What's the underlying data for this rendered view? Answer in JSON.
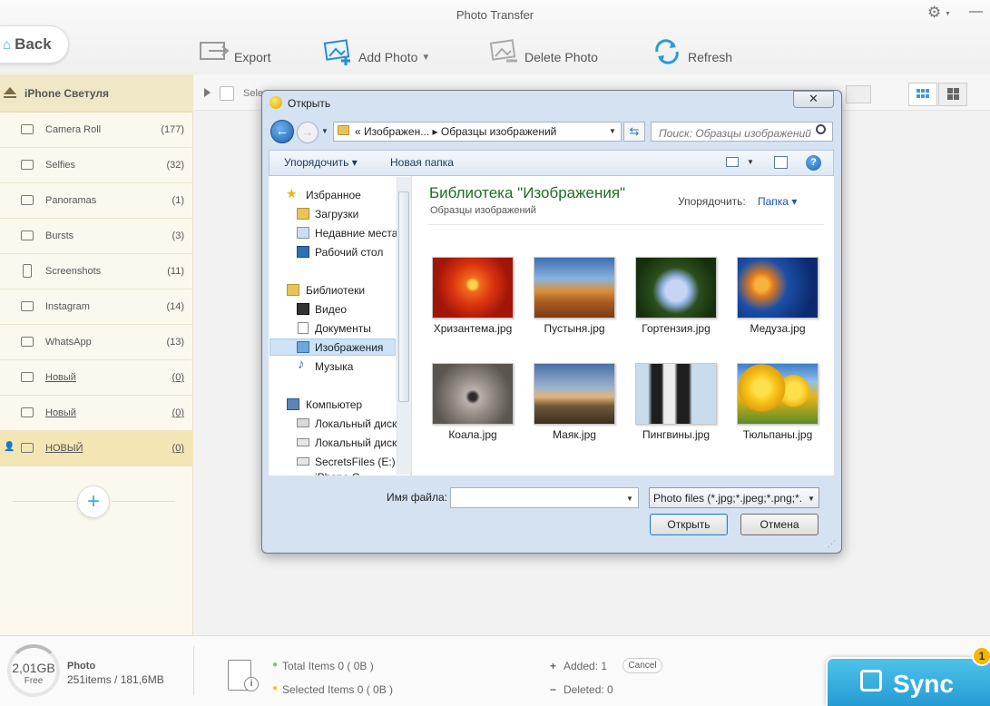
{
  "app": {
    "title": "Photo Transfer",
    "back_label": "Back"
  },
  "toolbar": {
    "export": "Export",
    "add_photo": "Add Photo",
    "delete_photo": "Delete Photo",
    "refresh": "Refresh"
  },
  "sidebar": {
    "device": "iPhone Светуля",
    "albums": [
      {
        "name": "Camera Roll",
        "count": "(177)"
      },
      {
        "name": "Selfies",
        "count": "(32)"
      },
      {
        "name": "Panoramas",
        "count": "(1)"
      },
      {
        "name": "Bursts",
        "count": "(3)"
      },
      {
        "name": "Screenshots",
        "count": "(11)"
      },
      {
        "name": "Instagram",
        "count": "(14)"
      },
      {
        "name": "WhatsApp",
        "count": "(13)"
      },
      {
        "name": "Новый",
        "count": "(0)"
      },
      {
        "name": "Новый",
        "count": "(0)"
      },
      {
        "name": "НОВЫЙ",
        "count": "(0)"
      }
    ]
  },
  "main": {
    "select_label": "Sele"
  },
  "footer": {
    "storage_size": "2,01GB",
    "storage_free": "Free",
    "storage_label": "Photo",
    "storage_detail": "251items / 181,6MB",
    "total_items": "Total Items 0 ( 0B )",
    "selected_items": "Selected Items 0 ( 0B )",
    "added": "Added: 1",
    "deleted": "Deleted: 0",
    "cancel": "Cancel",
    "plus": "+",
    "minus": "−",
    "sync": "Sync",
    "sync_badge": "1"
  },
  "dialog": {
    "title": "Открыть",
    "close": "✕",
    "address": "«  Изображен...  ▸  Образцы изображений",
    "search_placeholder": "Поиск: Образцы изображений",
    "organize": "Упорядочить ▾",
    "new_folder": "Новая папка",
    "nav": {
      "favorites": "Избранное",
      "downloads": "Загрузки",
      "recent": "Недавние места",
      "desktop": "Рабочий стол",
      "libraries": "Библиотеки",
      "video": "Видео",
      "documents": "Документы",
      "pictures": "Изображения",
      "music": "Музыка",
      "computer": "Компьютер",
      "local_disk_1": "Локальный диск",
      "local_disk_2": "Локальный диск",
      "secrets": "SecretsFiles (E:)",
      "iphone": "iPhone С..."
    },
    "library_title": "Библиотека \"Изображения\"",
    "library_sub": "Образцы изображений",
    "arrange_label": "Упорядочить:",
    "arrange_value": "Папка ▾",
    "files": [
      {
        "name": "Хризантема.jpg"
      },
      {
        "name": "Пустыня.jpg"
      },
      {
        "name": "Гортензия.jpg"
      },
      {
        "name": "Медуза.jpg"
      },
      {
        "name": "Коала.jpg"
      },
      {
        "name": "Маяк.jpg"
      },
      {
        "name": "Пингвины.jpg"
      },
      {
        "name": "Тюльпаны.jpg"
      }
    ],
    "filename_label": "Имя файла:",
    "filename_value": "",
    "filetype": "Photo files (*.jpg;*.jpeg;*.png;*.",
    "open": "Открыть",
    "cancel": "Отмена"
  },
  "colors": {
    "accent": "#259bd4",
    "sidebar_selected": "#f3e6b4",
    "sync_badge": "#f7b500"
  }
}
